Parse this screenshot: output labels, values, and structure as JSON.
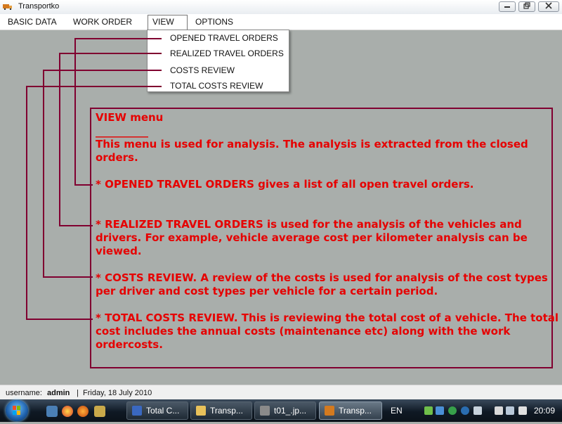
{
  "window": {
    "title": "Transportko"
  },
  "menubar": {
    "items": [
      "BASIC DATA",
      "WORK ORDER",
      "VIEW",
      "OPTIONS"
    ],
    "active": "VIEW"
  },
  "view_menu": {
    "items": [
      "OPENED TRAVEL ORDERS",
      "REALIZED TRAVEL ORDERS",
      "COSTS REVIEW",
      "TOTAL COSTS REVIEW"
    ]
  },
  "help": {
    "heading": "VIEW menu",
    "underline": "__________",
    "intro_line1": "This menu is used for analysis. The analysis is extracted from the closed",
    "intro_line2": "orders.",
    "opened_line1": "* OPENED TRAVEL ORDERS gives a list of all open travel orders.",
    "realized_line1": "* REALIZED TRAVEL ORDERS is used for the analysis of the vehicles and",
    "realized_line2": "drivers. For example, vehicle average cost per kilometer analysis can be",
    "realized_line3": "viewed.",
    "costs_line1": "* COSTS REVIEW. A review of the costs is used for analysis of the cost types",
    "costs_line2": "per driver and cost types per vehicle for a certain period.",
    "total_line1": "* TOTAL COSTS REVIEW. This is reviewing the total cost of a vehicle. The total",
    "total_line2": "cost includes the annual costs (maintenance etc) along with the work",
    "total_line3": "ordercosts."
  },
  "status": {
    "username_label": "username:",
    "username": "admin",
    "separator": "|",
    "date": "Friday, 18 July 2010"
  },
  "taskbar": {
    "buttons": [
      "Total C...",
      "Transp...",
      "t01_.jp...",
      "Transp..."
    ],
    "language": "EN",
    "clock": "20:09"
  },
  "colors": {
    "help_text": "#e60000",
    "connector": "#800030",
    "workspace": "#a9aeab"
  }
}
